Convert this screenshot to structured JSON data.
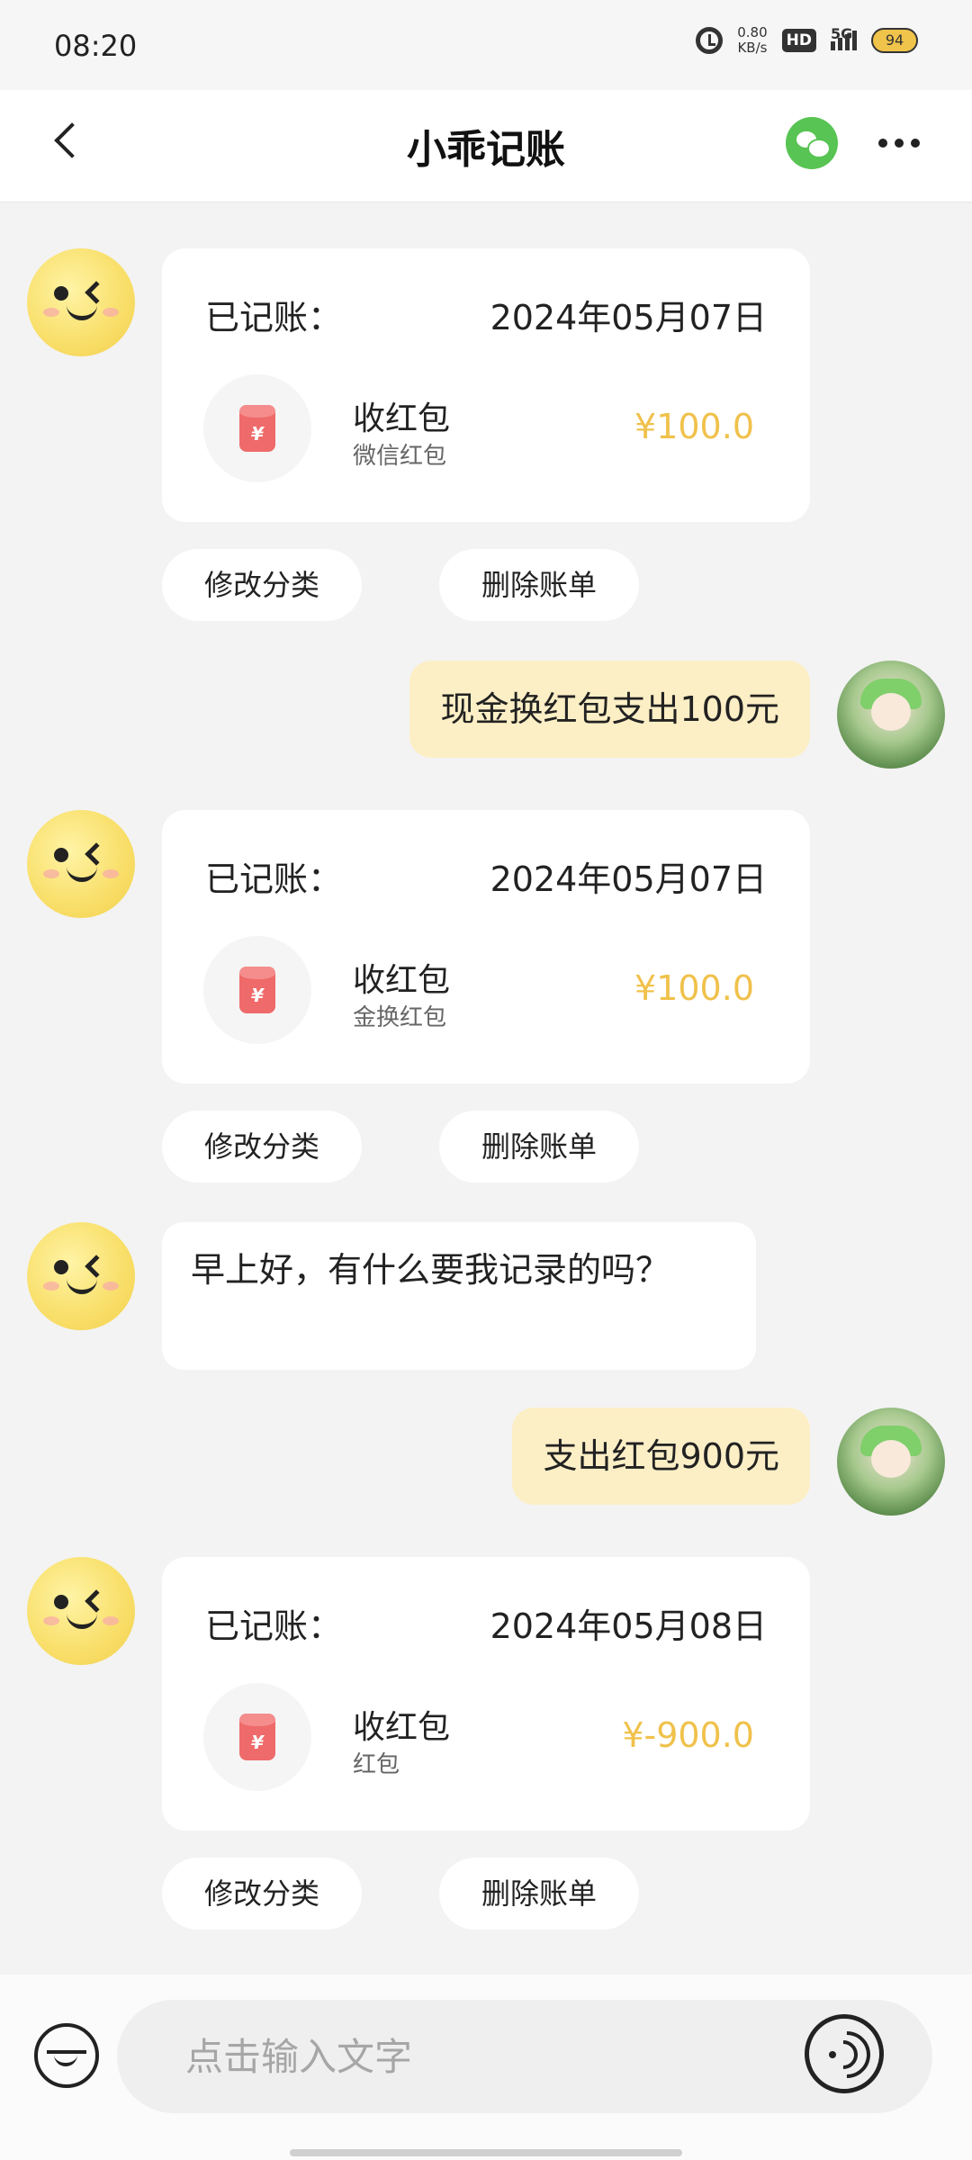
{
  "status_bar": {
    "time": "08:20",
    "net_speed_value": "0.80",
    "net_speed_unit": "KB/s",
    "hd_label": "HD",
    "network_label": "5G",
    "battery": "94"
  },
  "header": {
    "title": "小乖记账"
  },
  "messages": {
    "card1": {
      "label": "已记账：",
      "date": "2024年05月07日",
      "category": "收红包",
      "sub": "微信红包",
      "amount": "¥100.0"
    },
    "card1_actions": {
      "edit": "修改分类",
      "delete": "删除账单"
    },
    "user1": "现金换红包支出100元",
    "card2": {
      "label": "已记账：",
      "date": "2024年05月07日",
      "category": "收红包",
      "sub": "金换红包",
      "amount": "¥100.0"
    },
    "card2_actions": {
      "edit": "修改分类",
      "delete": "删除账单"
    },
    "bot_text": "早上好，有什么要我记录的吗？",
    "user2": "支出红包900元",
    "card3": {
      "label": "已记账：",
      "date": "2024年05月08日",
      "category": "收红包",
      "sub": "红包",
      "amount": "¥-900.0"
    },
    "card3_actions": {
      "edit": "修改分类",
      "delete": "删除账单"
    }
  },
  "input": {
    "placeholder": "点击输入文字"
  },
  "colors": {
    "accent_amount": "#f0c14b",
    "user_bubble": "#fcefc6",
    "wechat_green": "#58c453",
    "red_packet": "#ef6a6a"
  },
  "icons": [
    "back-icon",
    "wechat-icon",
    "more-icon",
    "red-packet-icon",
    "card-icon",
    "voice-icon"
  ]
}
